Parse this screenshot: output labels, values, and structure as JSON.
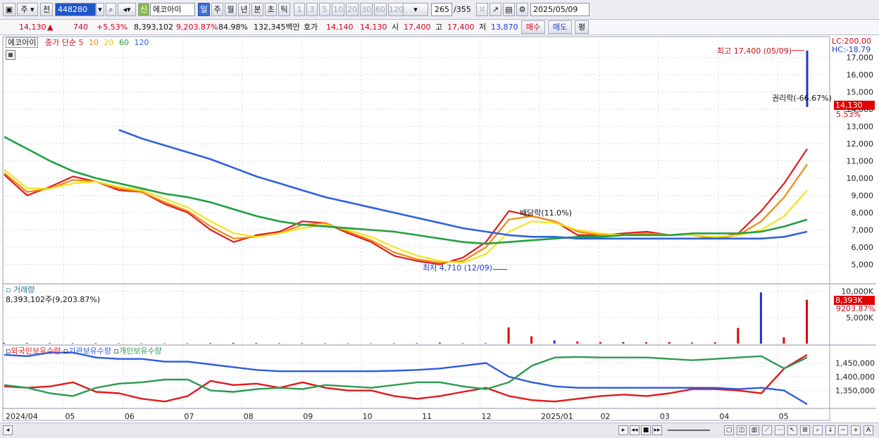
{
  "toolbar": {
    "period_label": "주",
    "prev_label": "전",
    "code": "448280",
    "name_badge": "신",
    "stock_name": "에코아이",
    "periods": [
      "일",
      "주",
      "월",
      "년",
      "분",
      "초",
      "틱"
    ],
    "active_period": "일",
    "intervals": [
      "1",
      "3",
      "5",
      "10",
      "20",
      "30",
      "60",
      "120"
    ],
    "count": "265",
    "total": "/355",
    "date": "2025/05/09"
  },
  "quote": {
    "price": "14,130",
    "change_arrow": "▲",
    "change": "740",
    "change_pct": "+5.53%",
    "volume": "8,393,102",
    "volume_ratio": "9,203.87%",
    "rate": "84.98%",
    "amount": "132,345백만",
    "ask_label": "호가",
    "ask": "14,140",
    "bid": "14,130",
    "open_label": "시",
    "open": "17,400",
    "high_label": "고",
    "high": "17,400",
    "low_label": "저",
    "low": "13,870",
    "buy_label": "매수",
    "sell_label": "매도",
    "eval_label": "평"
  },
  "legend": {
    "name": "에코아이",
    "title": "종가 단순",
    "ma_periods": [
      "5",
      "10",
      "20",
      "60",
      "120"
    ],
    "volume_title": "거래량",
    "volume_value": "8,393,102주(9,203.87%)",
    "holdings": [
      "외국인보유수량",
      "기관보유수량",
      "개인보유수량"
    ]
  },
  "right_labels": {
    "lc": "LC:200.00",
    "hc": "HC:-18.79",
    "price_tag": "14,130",
    "pct_tag": "5.53%",
    "vol_tag": "8,393K",
    "vol_pct_tag": "9203.87%"
  },
  "annotations": {
    "high": "최고 17,400 (05/09)",
    "low": "최저 4,710 (12/09)",
    "dividend": "배당락(11.0%)",
    "rights": "권리락(-66.67%)"
  },
  "colors": {
    "up": "#e00000",
    "down": "#1d35d8",
    "ma5": "#e01b1b",
    "ma10": "#f08a10",
    "ma20": "#f1e41e",
    "ma60": "#21a040",
    "ma120": "#2f62e0",
    "foreign": "#e01b1b",
    "institution": "#2d5be0",
    "individual": "#2e9a52"
  },
  "chart_data": [
    {
      "type": "line",
      "title": "에코아이 종가 단순",
      "x": [
        "2024/04",
        "05",
        "06",
        "07",
        "08",
        "09",
        "10",
        "11",
        "12",
        "2025/01",
        "02",
        "03",
        "04",
        "05"
      ],
      "price_axis_ticks": [
        5000,
        6000,
        7000,
        8000,
        9000,
        10000,
        11000,
        12000,
        13000,
        14000,
        15000,
        16000,
        17000
      ],
      "ylim": [
        4000,
        17800
      ],
      "high": {
        "value": 17400,
        "date": "05/09"
      },
      "low": {
        "value": 4710,
        "date": "12/09"
      },
      "last_close": 14130,
      "series": [
        {
          "name": "5",
          "values": [
            10200,
            9000,
            9500,
            10100,
            9800,
            9300,
            9200,
            8500,
            8000,
            7000,
            6300,
            6700,
            6900,
            7500,
            7400,
            6800,
            6300,
            5500,
            5200,
            5000,
            5400,
            6300,
            8100,
            7800,
            7500,
            6700,
            6700,
            6800,
            6900,
            6700,
            6700,
            6500,
            6800,
            8100,
            9700,
            11700
          ]
        },
        {
          "name": "10",
          "values": [
            10300,
            9200,
            9400,
            9900,
            9800,
            9400,
            9200,
            8600,
            8100,
            7200,
            6500,
            6600,
            6800,
            7300,
            7400,
            6900,
            6400,
            5700,
            5300,
            5100,
            5200,
            6000,
            7600,
            7800,
            7500,
            6900,
            6700,
            6700,
            6800,
            6700,
            6700,
            6500,
            6700,
            7500,
            8900,
            10800
          ]
        },
        {
          "name": "20",
          "values": [
            10500,
            9400,
            9400,
            9700,
            9800,
            9500,
            9300,
            8800,
            8300,
            7500,
            6800,
            6600,
            6800,
            7100,
            7300,
            7000,
            6600,
            6000,
            5500,
            5200,
            5100,
            5600,
            6900,
            7500,
            7400,
            7000,
            6800,
            6700,
            6700,
            6700,
            6700,
            6600,
            6700,
            7000,
            7800,
            9300
          ]
        },
        {
          "name": "60",
          "values": [
            12400,
            11700,
            11000,
            10400,
            10000,
            9700,
            9400,
            9100,
            8900,
            8600,
            8200,
            7800,
            7500,
            7300,
            7200,
            7100,
            7000,
            6900,
            6700,
            6500,
            6300,
            6200,
            6300,
            6400,
            6500,
            6600,
            6600,
            6700,
            6700,
            6700,
            6800,
            6800,
            6800,
            6900,
            7200,
            7600
          ]
        },
        {
          "name": "120",
          "values": [
            null,
            null,
            null,
            null,
            null,
            12800,
            12300,
            11900,
            11500,
            11100,
            10600,
            10100,
            9700,
            9300,
            8900,
            8600,
            8300,
            8000,
            7700,
            7400,
            7100,
            6900,
            6700,
            6600,
            6600,
            6500,
            6500,
            6500,
            6500,
            6500,
            6500,
            6500,
            6500,
            6500,
            6600,
            6900
          ]
        }
      ]
    },
    {
      "type": "bar",
      "title": "거래량",
      "y_axis_ticks": [
        5000,
        10000
      ],
      "y_unit": "K",
      "ylim": [
        0,
        10500
      ],
      "values": [
        150,
        120,
        100,
        90,
        90,
        80,
        70,
        70,
        80,
        110,
        150,
        120,
        90,
        100,
        80,
        70,
        70,
        80,
        90,
        200,
        90,
        90,
        3100,
        1400,
        600,
        400,
        300,
        300,
        250,
        300,
        200,
        250,
        3000,
        9800,
        1200,
        8393
      ]
    },
    {
      "type": "line",
      "title": "외국인보유수량",
      "y_axis_ticks": [
        1350000,
        1400000,
        1450000
      ],
      "ylim": [
        1290000,
        1500000
      ],
      "series": [
        {
          "name": "외국인보유수량",
          "values": [
            1365000,
            1360000,
            1365000,
            1380000,
            1345000,
            1340000,
            1320000,
            1310000,
            1330000,
            1385000,
            1370000,
            1375000,
            1360000,
            1380000,
            1360000,
            1350000,
            1350000,
            1330000,
            1320000,
            1330000,
            1345000,
            1360000,
            1330000,
            1315000,
            1310000,
            1320000,
            1330000,
            1335000,
            1330000,
            1340000,
            1355000,
            1355000,
            1350000,
            1340000,
            1430000,
            1480000
          ]
        },
        {
          "name": "기관보유수량",
          "values": [
            1480000,
            1475000,
            1488000,
            1488000,
            1470000,
            1465000,
            1465000,
            1455000,
            1455000,
            1445000,
            1435000,
            1425000,
            1420000,
            1420000,
            1420000,
            1420000,
            1420000,
            1422000,
            1425000,
            1430000,
            1440000,
            1450000,
            1400000,
            1380000,
            1365000,
            1360000,
            1360000,
            1360000,
            1360000,
            1360000,
            1360000,
            1360000,
            1355000,
            1360000,
            1350000,
            1300000
          ]
        },
        {
          "name": "개인보유수량",
          "values": [
            1370000,
            1360000,
            1340000,
            1330000,
            1360000,
            1375000,
            1380000,
            1390000,
            1390000,
            1350000,
            1345000,
            1355000,
            1360000,
            1355000,
            1370000,
            1365000,
            1360000,
            1370000,
            1380000,
            1380000,
            1365000,
            1355000,
            1380000,
            1440000,
            1470000,
            1472000,
            1470000,
            1470000,
            1470000,
            1465000,
            1460000,
            1465000,
            1470000,
            1475000,
            1430000,
            1470000
          ]
        }
      ]
    }
  ]
}
